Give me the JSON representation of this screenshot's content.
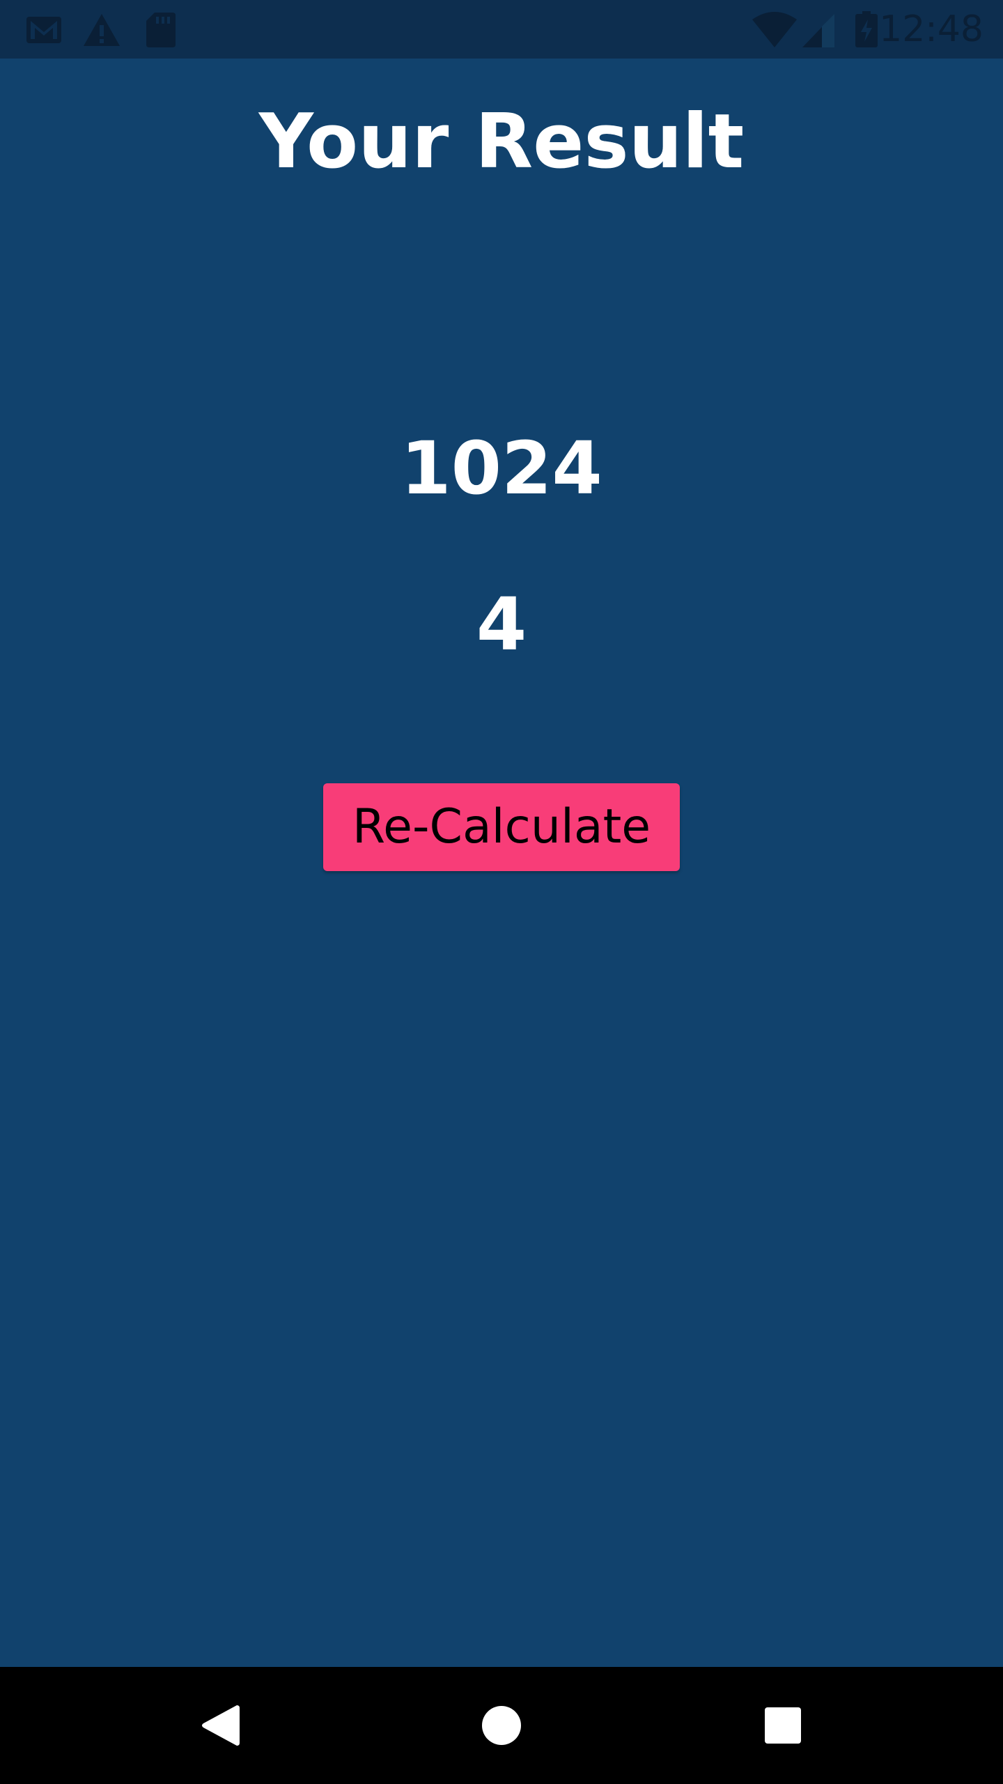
{
  "status_bar": {
    "time": "12:48",
    "icons": [
      "gmail-icon",
      "warning-icon",
      "sd-card-icon",
      "wifi-icon",
      "cellular-signal-icon",
      "battery-charging-icon"
    ]
  },
  "page": {
    "title": "Your Result",
    "result_primary": "1024",
    "result_secondary": "4",
    "recalculate_label": "Re-Calculate"
  },
  "nav_bar": {
    "icons": [
      "back-icon",
      "home-icon",
      "recents-icon"
    ]
  },
  "colors": {
    "background": "#11426d",
    "status_bar": "#0d2e4f",
    "accent_button": "#f83d78",
    "nav_bar": "#000000",
    "text": "#ffffff"
  }
}
